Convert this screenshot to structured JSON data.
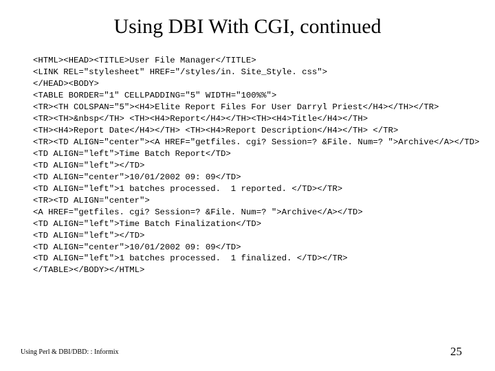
{
  "title": "Using DBI With CGI, continued",
  "code_lines": [
    "<HTML><HEAD><TITLE>User File Manager</TITLE>",
    "<LINK REL=\"stylesheet\" HREF=\"/styles/in. Site_Style. css\">",
    "</HEAD><BODY>",
    "<TABLE BORDER=\"1\" CELLPADDING=\"5\" WIDTH=\"100%%\">",
    "<TR><TH COLSPAN=\"5\"><H4>Elite Report Files For User Darryl Priest</H4></TH></TR>",
    "<TR><TH>&nbsp</TH> <TH><H4>Report</H4></TH><TH><H4>Title</H4></TH>",
    "<TH><H4>Report Date</H4></TH> <TH><H4>Report Description</H4></TH> </TR>",
    "<TR><TD ALIGN=\"center\"><A HREF=\"getfiles. cgi? Session=? &File. Num=? \">Archive</A></TD>",
    "<TD ALIGN=\"left\">Time Batch Report</TD>",
    "<TD ALIGN=\"left\"></TD>",
    "<TD ALIGN=\"center\">10/01/2002 09: 09</TD>",
    "<TD ALIGN=\"left\">1 batches processed.  1 reported. </TD></TR>",
    "<TR><TD ALIGN=\"center\">",
    "<A HREF=\"getfiles. cgi? Session=? &File. Num=? \">Archive</A></TD>",
    "<TD ALIGN=\"left\">Time Batch Finalization</TD>",
    "<TD ALIGN=\"left\"></TD>",
    "<TD ALIGN=\"center\">10/01/2002 09: 09</TD>",
    "<TD ALIGN=\"left\">1 batches processed.  1 finalized. </TD></TR>",
    "</TABLE></BODY></HTML>"
  ],
  "footer_left": "Using Perl & DBI/DBD: : Informix",
  "footer_right": "25"
}
